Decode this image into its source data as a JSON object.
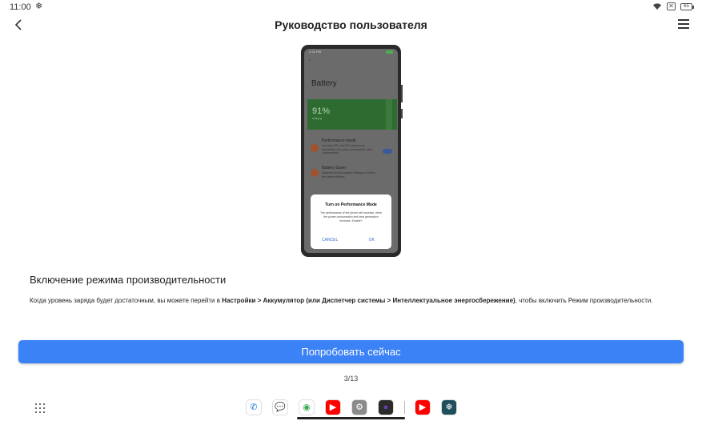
{
  "status_bar": {
    "time": "11:00",
    "snow_glyph": "❄",
    "box_glyph": "✕",
    "battery_text": "65"
  },
  "header": {
    "title": "Руководство пользователя",
    "back_icon": "chevron-left-icon",
    "menu_icon": "hamburger-menu-icon"
  },
  "illustration": {
    "status_time": "2:22 PM",
    "screen_title": "Battery",
    "battery_percent": "91%",
    "battery_state": "Charging",
    "performance_title": "Performance mode",
    "performance_desc": "Increase CPU and GPU frequency. Meanwhile, the power consumption rises consequently.",
    "saver_title": "Battery Saver",
    "saver_desc": "Optimize several system settings to extend the battery lifetime",
    "dialog_title": "Turn on Performance Mode",
    "dialog_body": "The performance of the phone will increase, while the power consumption and heat generation increase. Enable?",
    "dialog_cancel": "CANCEL",
    "dialog_ok": "OK"
  },
  "content": {
    "heading": "Включение режима производительности",
    "desc_part1": "Когда уровень заряда будет достаточным, вы можете перейти в ",
    "desc_bold": "Настройки > Аккумулятор (или Диспетчер системы > Интеллектуальное энергосбережение)",
    "desc_part2": ", чтобы включить Режим производительности."
  },
  "action": {
    "try_now_label": "Попробовать сейчас"
  },
  "pager": {
    "text": "3/13"
  },
  "dock": {
    "apps": [
      {
        "name": "phone-app",
        "glyph": "✆",
        "color": "#1a73e8",
        "bg": "#ffffff"
      },
      {
        "name": "messages-app",
        "glyph": "💬",
        "color": "#1a73e8",
        "bg": "#ffffff"
      },
      {
        "name": "chrome-app",
        "glyph": "◉",
        "color": "#34a853",
        "bg": "#ffffff"
      },
      {
        "name": "youtube-app",
        "glyph": "▶",
        "color": "#ffffff",
        "bg": "#ff0000"
      },
      {
        "name": "settings-app",
        "glyph": "⚙",
        "color": "#ffffff",
        "bg": "#8a8a8a"
      },
      {
        "name": "camera-app",
        "glyph": "●",
        "color": "#6a3fb5",
        "bg": "#2b2b2b"
      },
      {
        "name": "youtube-recent-app",
        "glyph": "▶",
        "color": "#ffffff",
        "bg": "#ff0000"
      },
      {
        "name": "snowflake-app",
        "glyph": "❄",
        "color": "#ffffff",
        "bg": "#1f4f5a"
      }
    ]
  }
}
